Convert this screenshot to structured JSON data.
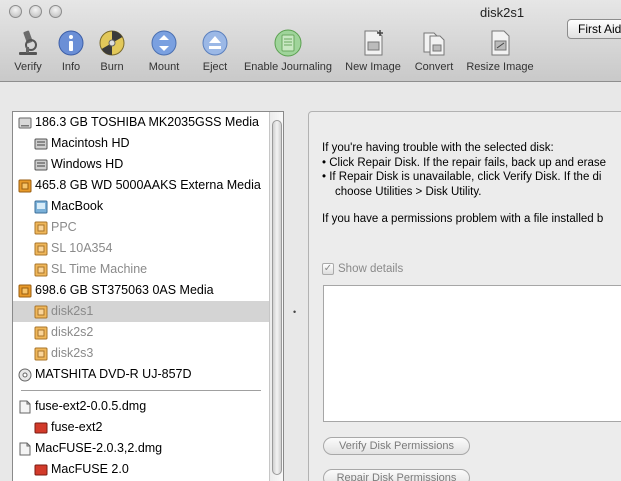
{
  "window": {
    "title": "disk2s1"
  },
  "toolbar": {
    "items": [
      {
        "label": "Verify",
        "icon": "microscope-icon"
      },
      {
        "label": "Info",
        "icon": "info-icon"
      },
      {
        "label": "Burn",
        "icon": "burn-icon"
      },
      {
        "label": "Mount",
        "icon": "mount-icon"
      },
      {
        "label": "Eject",
        "icon": "eject-icon"
      },
      {
        "label": "Enable Journaling",
        "icon": "journal-icon"
      },
      {
        "label": "New Image",
        "icon": "new-image-icon"
      },
      {
        "label": "Convert",
        "icon": "convert-icon"
      },
      {
        "label": "Resize Image",
        "icon": "resize-image-icon"
      }
    ]
  },
  "sidebar": {
    "items": [
      {
        "label": "186.3 GB TOSHIBA MK2035GSS Media",
        "level": 0,
        "kind": "drive"
      },
      {
        "label": "Macintosh HD",
        "level": 1,
        "kind": "volume"
      },
      {
        "label": "Windows HD",
        "level": 1,
        "kind": "volume"
      },
      {
        "label": "465.8 GB WD 5000AAKS Externa Media",
        "level": 0,
        "kind": "ext-drive"
      },
      {
        "label": "MacBook",
        "level": 1,
        "kind": "macbook"
      },
      {
        "label": "PPC",
        "level": 1,
        "kind": "ext-vol",
        "dim": true
      },
      {
        "label": "SL 10A354",
        "level": 1,
        "kind": "ext-vol",
        "dim": true
      },
      {
        "label": "SL Time Machine",
        "level": 1,
        "kind": "ext-vol",
        "dim": true
      },
      {
        "label": "698.6 GB ST375063 0AS Media",
        "level": 0,
        "kind": "ext-drive"
      },
      {
        "label": "disk2s1",
        "level": 1,
        "kind": "ext-vol",
        "dim": true,
        "selected": true
      },
      {
        "label": "disk2s2",
        "level": 1,
        "kind": "ext-vol",
        "dim": true
      },
      {
        "label": "disk2s3",
        "level": 1,
        "kind": "ext-vol",
        "dim": true
      },
      {
        "label": "MATSHITA DVD-R UJ-857D",
        "level": 0,
        "kind": "optical"
      }
    ],
    "images": [
      {
        "label": "fuse-ext2-0.0.5.dmg",
        "level": 0,
        "kind": "dmg"
      },
      {
        "label": "fuse-ext2",
        "level": 1,
        "kind": "red-vol"
      },
      {
        "label": "MacFUSE-2.0.3,2.dmg",
        "level": 0,
        "kind": "dmg"
      },
      {
        "label": "MacFUSE 2.0",
        "level": 1,
        "kind": "red-vol"
      }
    ]
  },
  "panel": {
    "tab_label": "First Aid",
    "line1": "If you're having trouble with the selected disk:",
    "bullet1": "• Click Repair Disk. If the repair fails, back up and erase",
    "bullet2a": "• If Repair Disk is unavailable, click Verify Disk. If the di",
    "bullet2b": "choose Utilities > Disk Utility.",
    "line_perm": "If you have a permissions problem with a file installed b",
    "show_details_label": "Show details",
    "show_details_checked": true,
    "verify_permissions_label": "Verify Disk Permissions",
    "repair_permissions_label": "Repair Disk Permissions"
  },
  "colors": {
    "selection": "#d4d4d4",
    "dim_text": "#8a8a8a",
    "ext_drive_orange": "#e89a2a",
    "red_volume": "#d23a2a"
  }
}
